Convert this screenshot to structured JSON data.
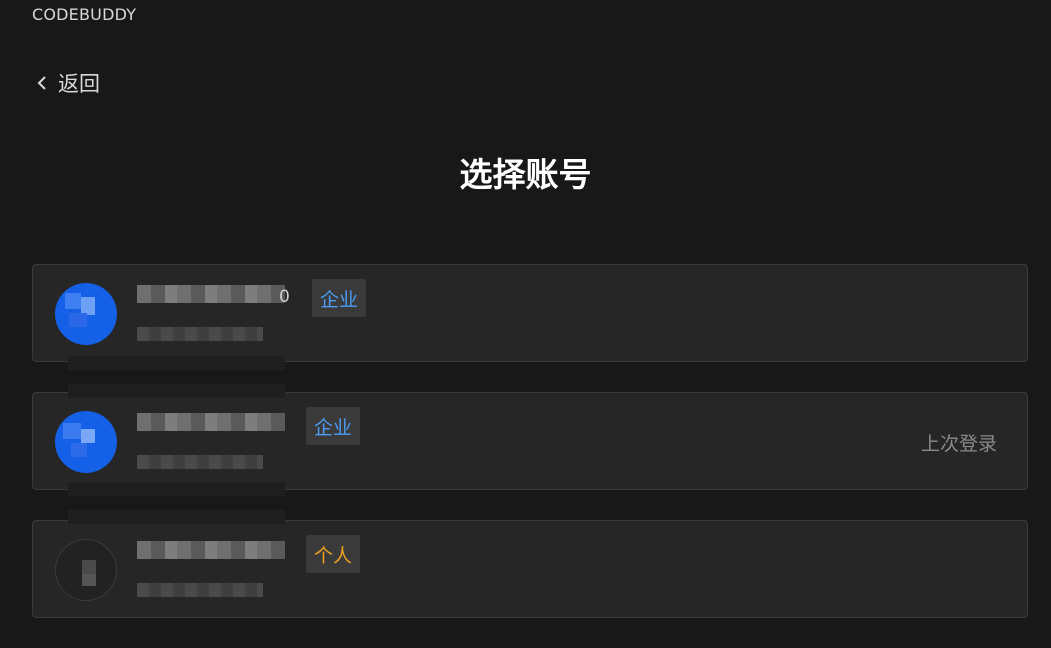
{
  "app": {
    "title": "CODEBUDDY"
  },
  "nav": {
    "back_label": "返回",
    "back_icon": "chevron-left-icon"
  },
  "page": {
    "title": "选择账号"
  },
  "accounts": [
    {
      "type_label": "企业",
      "type": "enterprise",
      "name_tail": "0",
      "last_login": ""
    },
    {
      "type_label": "企业",
      "type": "enterprise",
      "name_tail": "",
      "last_login": "上次登录"
    },
    {
      "type_label": "个人",
      "type": "personal",
      "name_tail": "",
      "last_login": ""
    }
  ],
  "colors": {
    "background": "#181818",
    "card": "#262626",
    "enterprise_tag": "#4a9cf5",
    "personal_tag": "#f0a020",
    "avatar_blue": "#1460e6"
  }
}
